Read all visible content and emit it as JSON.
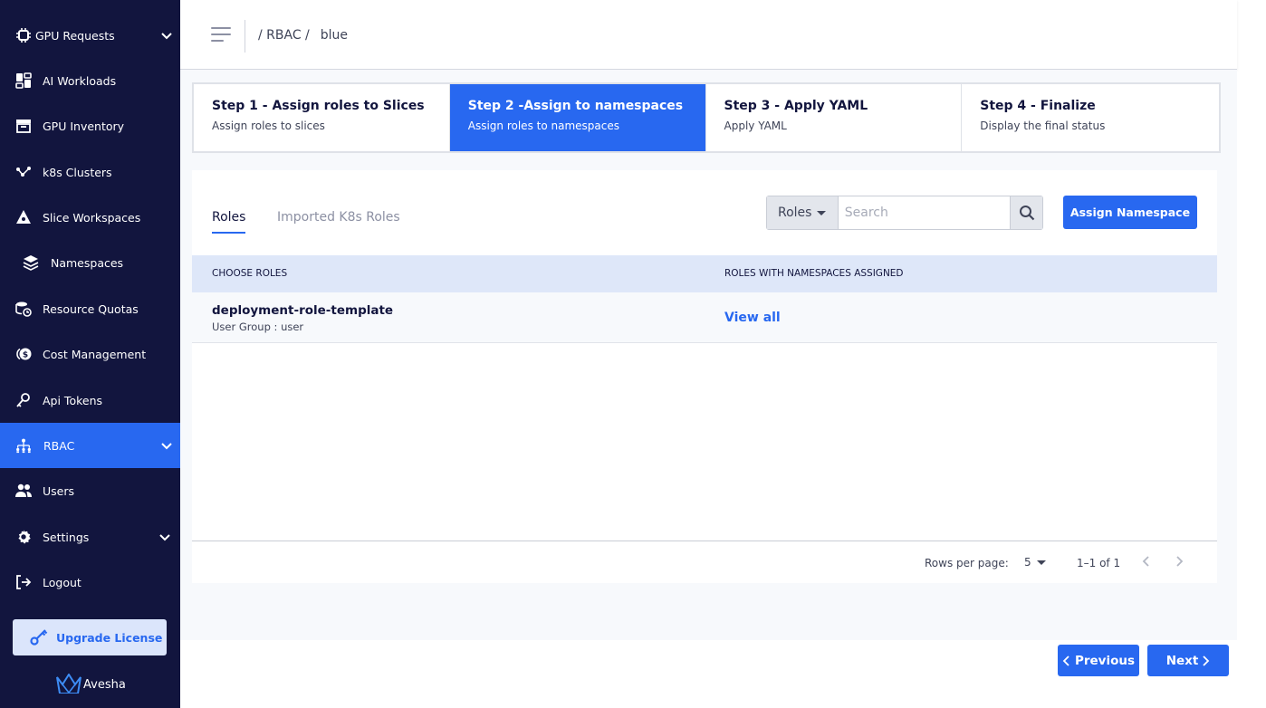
{
  "sidebar": {
    "items": [
      {
        "label": "GPU Requests",
        "icon": "chip-icon",
        "expandable": true
      },
      {
        "label": "AI Workloads",
        "icon": "dashboard-icon"
      },
      {
        "label": "GPU Inventory",
        "icon": "inventory-icon"
      },
      {
        "label": "k8s Clusters",
        "icon": "clusters-icon"
      },
      {
        "label": "Slice Workspaces",
        "icon": "workspace-icon"
      },
      {
        "label": "Namespaces",
        "icon": "layers-icon"
      },
      {
        "label": "Resource Quotas",
        "icon": "quota-icon"
      },
      {
        "label": "Cost Management",
        "icon": "cost-icon"
      },
      {
        "label": "Api Tokens",
        "icon": "key-icon"
      },
      {
        "label": "RBAC",
        "icon": "rbac-icon",
        "active": true,
        "expandable": true
      },
      {
        "label": "Users",
        "icon": "users-icon"
      },
      {
        "label": "Settings",
        "icon": "gear-icon",
        "expandable": true
      },
      {
        "label": "Logout",
        "icon": "logout-icon"
      }
    ],
    "upgrade_label": "Upgrade License",
    "brand_name": "Avesha"
  },
  "header": {
    "breadcrumb_prefix": "/ RBAC /",
    "breadcrumb_current": "blue"
  },
  "stepper": {
    "steps": [
      {
        "title": "Step 1 - Assign roles to Slices",
        "subtitle": "Assign roles to slices"
      },
      {
        "title": "Step 2 -Assign to namespaces",
        "subtitle": "Assign roles to namespaces",
        "active": true
      },
      {
        "title": "Step 3 - Apply YAML",
        "subtitle": "Apply YAML"
      },
      {
        "title": "Step 4 - Finalize",
        "subtitle": "Display the final status"
      }
    ]
  },
  "tabs": {
    "roles": "Roles",
    "imported": "Imported K8s Roles"
  },
  "search": {
    "filter_value": "Roles",
    "placeholder": "Search"
  },
  "assign_button": "Assign Namespace",
  "table": {
    "headers": [
      "CHOOSE ROLES",
      "ROLES WITH NAMESPACES ASSIGNED"
    ],
    "rows": [
      {
        "role": "deployment-role-template",
        "group": "User Group : user",
        "action": "View all"
      }
    ],
    "footer": {
      "rows_per_page_label": "Rows per page:",
      "rows_per_page_value": "5",
      "range": "1–1 of 1"
    }
  },
  "nav_buttons": {
    "previous": "Previous",
    "next": "Next"
  },
  "colors": {
    "sidebar_bg": "#12153e",
    "accent": "#2868f0",
    "header_row_bg": "#dee7f9"
  }
}
